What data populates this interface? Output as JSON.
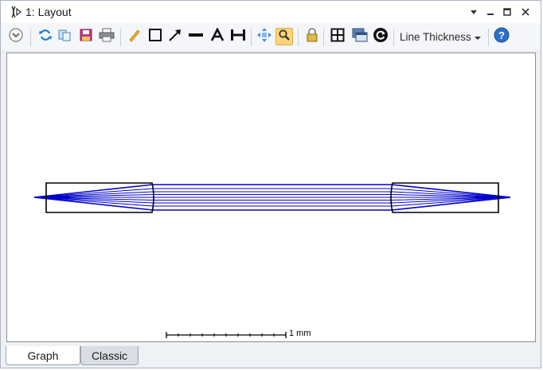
{
  "window": {
    "title": "1: Layout"
  },
  "toolbar": {
    "buttons": [
      {
        "name": "settings-chevron-button",
        "icon": "chevron-down-circle-icon"
      },
      {
        "name": "update-button",
        "icon": "refresh-icon"
      },
      {
        "name": "copy-button",
        "icon": "copy-icon"
      },
      {
        "name": "save-button",
        "icon": "save-icon"
      },
      {
        "name": "print-button",
        "icon": "printer-icon"
      },
      {
        "name": "pencil-button",
        "icon": "pencil-icon"
      },
      {
        "name": "rectangle-button",
        "icon": "rectangle-icon"
      },
      {
        "name": "arrow-button",
        "icon": "arrow-icon"
      },
      {
        "name": "line-button",
        "icon": "line-icon"
      },
      {
        "name": "text-button",
        "icon": "text-icon"
      },
      {
        "name": "dimension-button",
        "icon": "dimension-icon"
      },
      {
        "name": "pan-button",
        "icon": "move-icon"
      },
      {
        "name": "zoom-button",
        "icon": "zoom-icon",
        "active": true
      },
      {
        "name": "lock-button",
        "icon": "lock-icon"
      },
      {
        "name": "grid-button",
        "icon": "grid-icon"
      },
      {
        "name": "window-button",
        "icon": "window-icon"
      },
      {
        "name": "rotate-button",
        "icon": "rotate-icon"
      },
      {
        "name": "help-button",
        "icon": "help-icon"
      }
    ],
    "line_thickness_label": "Line Thickness"
  },
  "layout_plot": {
    "scale_bar_label": "1 mm",
    "ray_color": "#0000cc",
    "lens_color": "#000000"
  },
  "tabs": [
    {
      "label": "Graph",
      "selected": true
    },
    {
      "label": "Classic",
      "selected": false
    }
  ]
}
